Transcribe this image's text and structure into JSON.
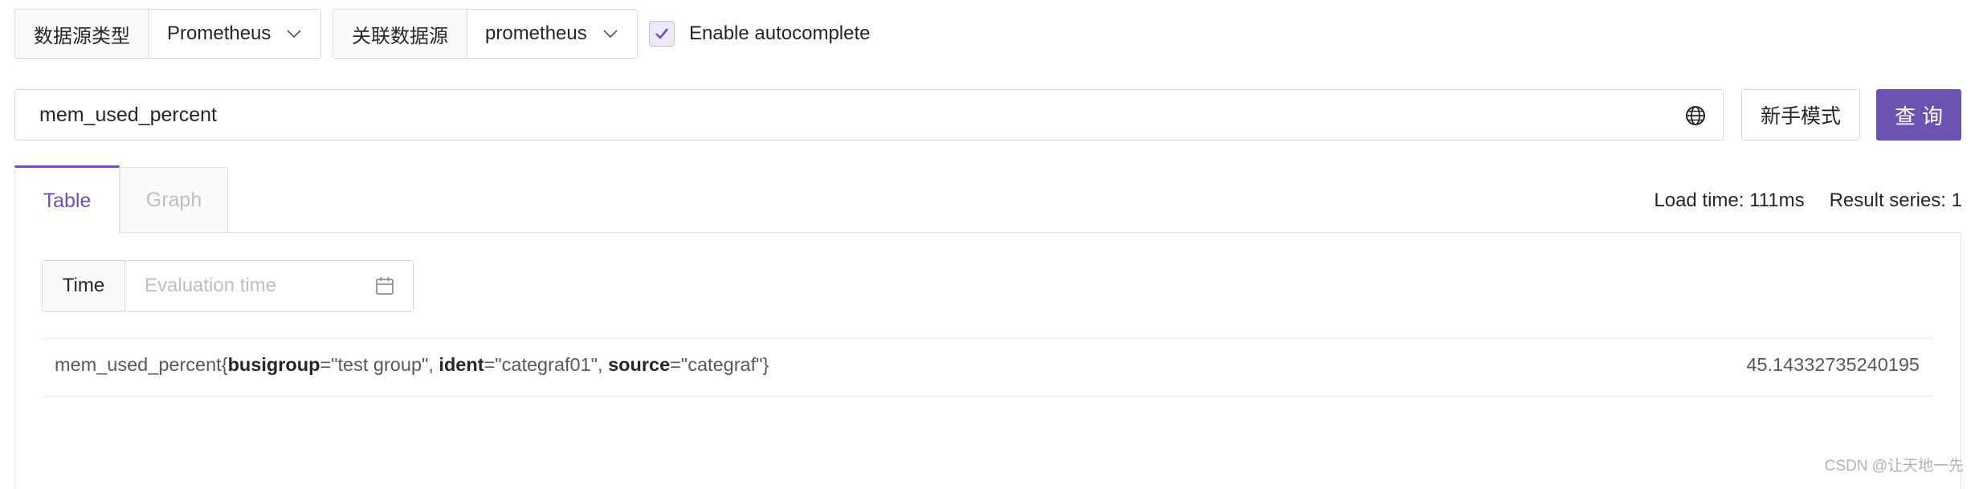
{
  "datasource": {
    "type_label": "数据源类型",
    "type_value": "Prometheus",
    "linked_label": "关联数据源",
    "linked_value": "prometheus"
  },
  "autocomplete": {
    "checked": true,
    "label": "Enable autocomplete"
  },
  "query": {
    "value": "mem_used_percent"
  },
  "buttons": {
    "beginner_mode": "新手模式",
    "query": "查询"
  },
  "tabs": [
    {
      "label": "Table",
      "active": true
    },
    {
      "label": "Graph",
      "active": false
    }
  ],
  "stats": {
    "load_time": "Load time: 111ms",
    "result_series": "Result series: 1"
  },
  "time": {
    "label": "Time",
    "placeholder": "Evaluation time"
  },
  "result": {
    "metric_name": "mem_used_percent",
    "open_brace": "{",
    "labels": [
      {
        "key": "busigroup",
        "value": "=\"test group\"",
        "sep": ", "
      },
      {
        "key": "ident",
        "value": "=\"categraf01\"",
        "sep": ", "
      },
      {
        "key": "source",
        "value": "=\"categraf\"",
        "sep": ""
      }
    ],
    "close_brace": "}",
    "value": "45.14332735240195"
  },
  "watermark": "CSDN @让天地一先",
  "colors": {
    "accent": "#6c53b1",
    "border": "#d9d9d9",
    "placeholder": "#bfbfbf"
  },
  "icons": [
    "chevron-down-icon",
    "check-icon",
    "globe-icon",
    "calendar-icon"
  ]
}
